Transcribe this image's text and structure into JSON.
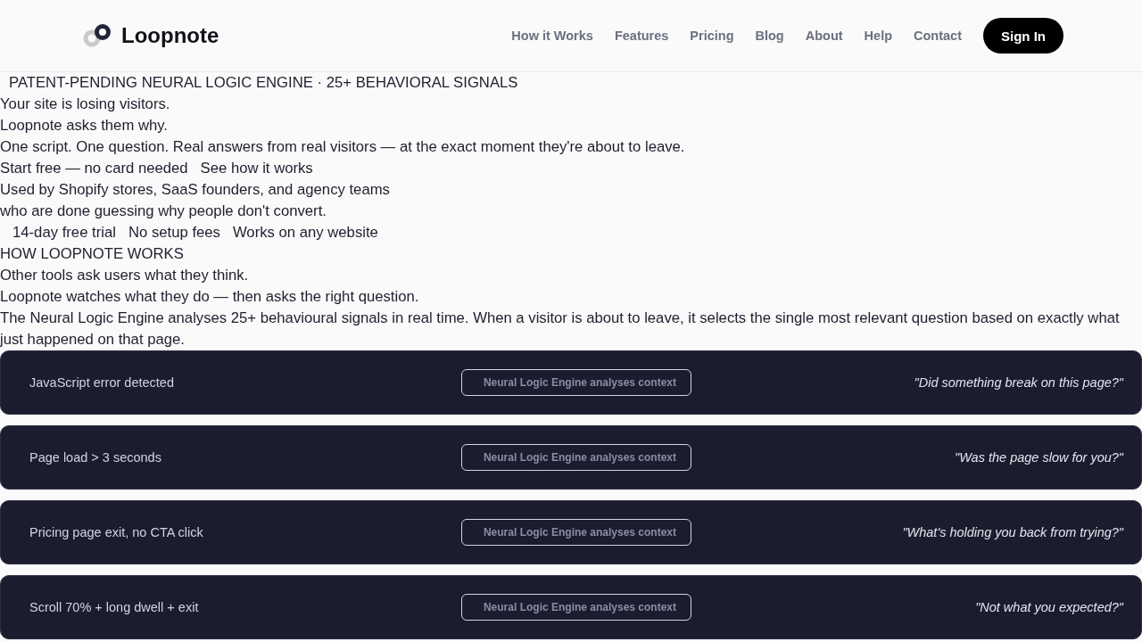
{
  "header": {
    "logo": "Loopnote",
    "nav": [
      "How it Works",
      "Features",
      "Pricing",
      "Blog",
      "About",
      "Help",
      "Contact"
    ],
    "sign_in": "Sign In"
  },
  "hero": {
    "badge": "PATENT-PENDING NEURAL LOGIC ENGINE · 25+ BEHAVIORAL SIGNALS",
    "headline": [
      "Your site is losing visitors.",
      "Loopnote asks them why."
    ],
    "subtitle": "One script. One question. Real answers from real visitors — at the exact moment they're about to leave.",
    "ctas": [
      "Start free — no card needed",
      "See how it works"
    ],
    "social_proof": [
      "Used by Shopify stores, SaaS founders, and agency teams",
      "who are done guessing why people don't convert."
    ],
    "perks": [
      "14-day free trial",
      "No setup fees",
      "Works on any website"
    ]
  },
  "how_it_works": {
    "eyebrow": "HOW LOOPNOTE WORKS",
    "heading": [
      "Other tools ask users what they think.",
      "Loopnote watches what they do — then asks the right question."
    ],
    "description": "The Neural Logic Engine analyses 25+ behavioural signals in real time. When a visitor is about to leave, it selects the single most relevant question based on exactly what just happened on that page.",
    "rows": [
      {
        "signal": "JavaScript error detected",
        "engine": "Neural Logic Engine analyses context",
        "question": "\"Did something break on this page?\""
      },
      {
        "signal": "Page load > 3 seconds",
        "engine": "Neural Logic Engine analyses context",
        "question": "\"Was the page slow for you?\""
      },
      {
        "signal": "Pricing page exit, no CTA click",
        "engine": "Neural Logic Engine analyses context",
        "question": "\"What's holding you back from trying?\""
      },
      {
        "signal": "Scroll 70% + long dwell + exit",
        "engine": "Neural Logic Engine analyses context",
        "question": "\"Not what you expected?\""
      }
    ]
  }
}
